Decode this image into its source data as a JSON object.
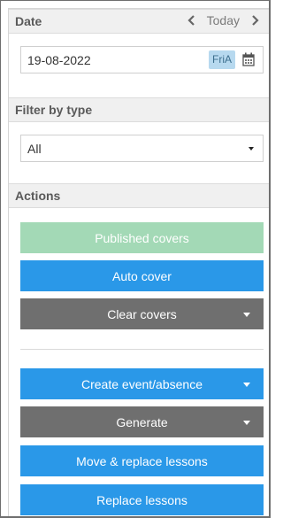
{
  "date_section": {
    "title": "Date",
    "prev_icon": "chevron-left-icon",
    "today_label": "Today",
    "next_icon": "chevron-right-icon",
    "date_value": "19-08-2022",
    "day_badge": "FriA",
    "calendar_icon": "calendar-icon"
  },
  "filter_section": {
    "title": "Filter by type",
    "selected": "All"
  },
  "actions_section": {
    "title": "Actions",
    "buttons": [
      {
        "label": "Published covers",
        "style": "disabled-green",
        "color": "#a3d9b6",
        "dropdown": false
      },
      {
        "label": "Auto cover",
        "style": "primary",
        "color": "#2a98e8",
        "dropdown": false
      },
      {
        "label": "Clear covers",
        "style": "secondary",
        "color": "#6f6f6f",
        "dropdown": true
      },
      {
        "label": "Create event/absence",
        "style": "primary",
        "color": "#2a98e8",
        "dropdown": true
      },
      {
        "label": "Generate",
        "style": "secondary",
        "color": "#6f6f6f",
        "dropdown": true
      },
      {
        "label": "Move & replace lessons",
        "style": "primary",
        "color": "#2a98e8",
        "dropdown": false
      },
      {
        "label": "Replace lessons",
        "style": "primary",
        "color": "#2a98e8",
        "dropdown": false
      }
    ]
  }
}
